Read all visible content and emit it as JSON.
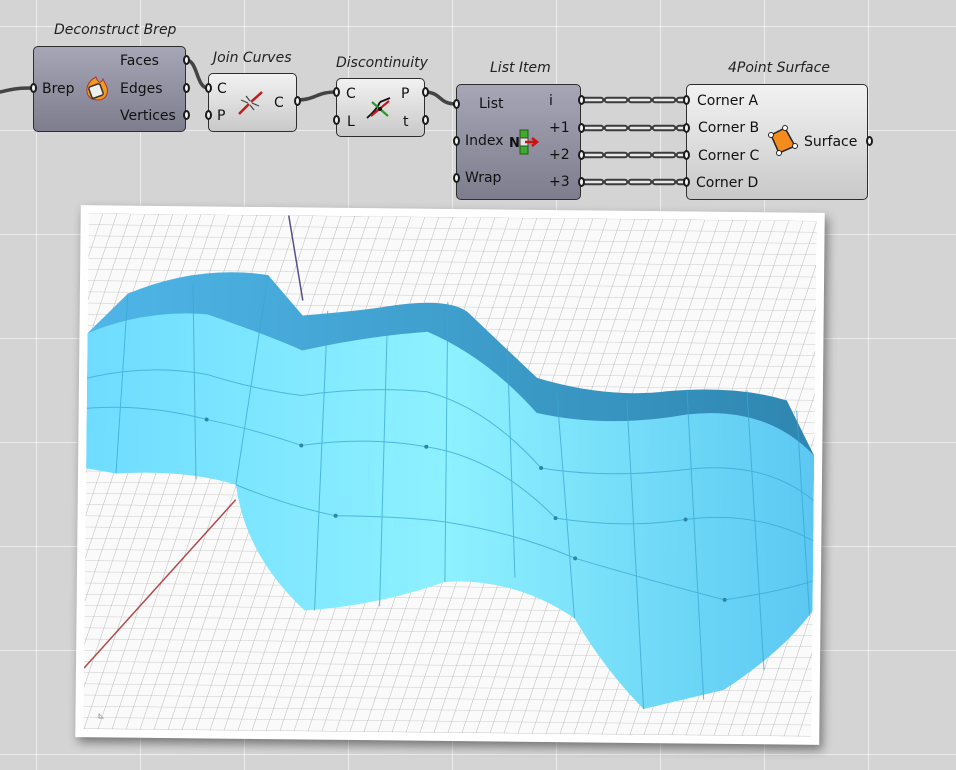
{
  "components": {
    "deconstruct_brep": {
      "title": "Deconstruct Brep",
      "input": "Brep",
      "outputs": [
        "Faces",
        "Edges",
        "Vertices"
      ]
    },
    "join_curves": {
      "title": "Join Curves",
      "inputs": [
        "C",
        "P"
      ],
      "output": "C"
    },
    "discontinuity": {
      "title": "Discontinuity",
      "inputs": [
        "C",
        "L"
      ],
      "outputs": [
        "P",
        "t"
      ]
    },
    "list_item": {
      "title": "List Item",
      "inputs": [
        "List",
        "Index",
        "Wrap"
      ],
      "outputs": [
        "i",
        "+1",
        "+2",
        "+3"
      ]
    },
    "four_point_surface": {
      "title": "4Point Surface",
      "inputs": [
        "Corner A",
        "Corner B",
        "Corner C",
        "Corner D"
      ],
      "output": "Surface"
    }
  },
  "colors": {
    "canvas": "#d4d4d4",
    "surface_light": "#7fe8ff",
    "surface_dark": "#3a9ec4",
    "component_face": "#d6d6d6"
  },
  "icons": [
    "brep-explode-icon",
    "join-curves-icon",
    "discontinuity-icon",
    "list-item-icon",
    "four-point-surface-icon"
  ]
}
